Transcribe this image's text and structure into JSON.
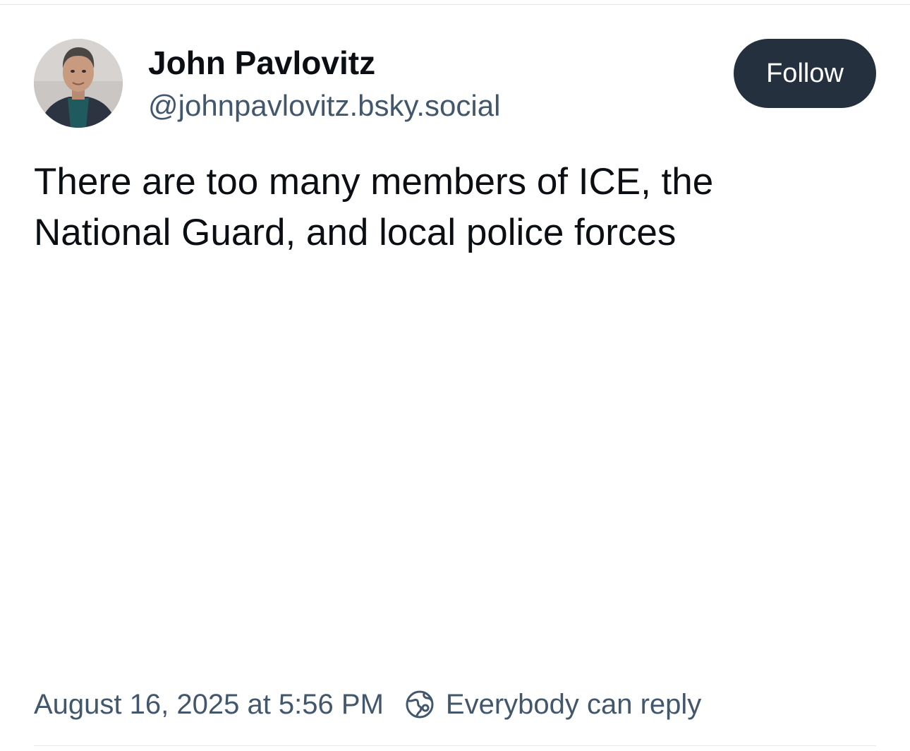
{
  "post": {
    "author": {
      "display_name": "John Pavlovitz",
      "handle": "@johnpavlovitz.bsky.social"
    },
    "follow_label": "Follow",
    "text": "There are too many members of ICE, the\nNational Guard, and local police forces",
    "timestamp": "August 16, 2025 at 5:56 PM",
    "reply_setting": "Everybody can reply",
    "icons": {
      "reply_setting": "globe-icon"
    }
  },
  "colors": {
    "follow_button_bg": "#25303f",
    "secondary_text": "#42576c",
    "primary_text": "#0b0f14"
  }
}
